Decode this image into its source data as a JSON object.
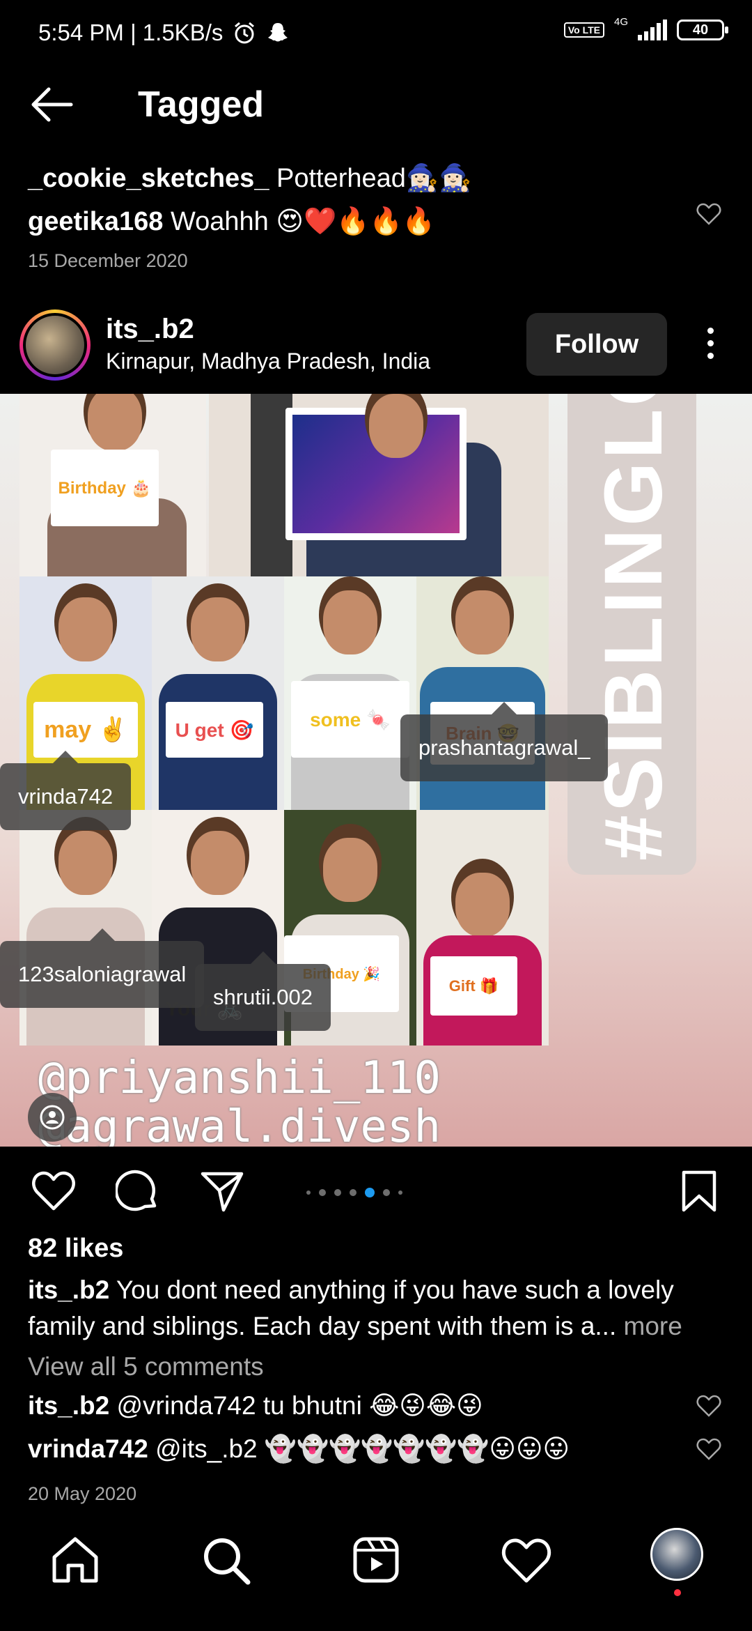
{
  "status_bar": {
    "time_speed": "5:54 PM | 1.5KB/s",
    "volte": "Vo LTE",
    "network": "4G",
    "battery": "40"
  },
  "header": {
    "title": "Tagged"
  },
  "previous_post": {
    "comments": [
      {
        "user": "_cookie_sketches_",
        "text": "Potterhead🧙🏻‍♀️🧙🏻‍♀️"
      },
      {
        "user": "geetika168",
        "text": "Woahhh 😍❤️🔥🔥🔥"
      }
    ],
    "date": "15 December 2020"
  },
  "post": {
    "username": "its_.b2",
    "location": "Kirnapur, Madhya Pradesh, India",
    "follow_label": "Follow",
    "image": {
      "signs": [
        "Birthday 🎂",
        "may ✌️",
        "U get 🎯",
        "some 🍬",
        "Brain 🤓",
        "Birthday 🎉",
        "Gift 🎁",
        "Your 🚲"
      ],
      "hashtag": "#SIBLINGLO",
      "overlay_lines": [
        "@priyanshii_110",
        "@agrawal.divesh"
      ],
      "tags": [
        "prashantagrawal_",
        "vrinda742",
        "123saloniagrawal",
        "shrutii.002"
      ]
    },
    "likes": "82 likes",
    "caption_user": "its_.b2",
    "caption_text": "You dont need anything if you have such a lovely family and siblings. Each day spent with them is a...",
    "caption_more": "more",
    "view_all": "View all 5 comments",
    "comments": [
      {
        "user": "its_.b2",
        "text": "@vrinda742 tu bhutni 😂😜😂😜"
      },
      {
        "user": "vrinda742",
        "text": "@its_.b2 👻👻👻👻👻👻👻😛😛😛"
      }
    ],
    "date": "20 May 2020"
  },
  "carousel": {
    "count": 7,
    "active_index": 4
  },
  "colors": {
    "background": "#000000",
    "accent": "#1d9bf0",
    "muted": "#a8a8a8",
    "button": "#262626",
    "notification": "#ff3040"
  },
  "icons": [
    "back-arrow-icon",
    "heart-icon",
    "comment-icon",
    "share-icon",
    "bookmark-icon",
    "more-icon",
    "home-icon",
    "search-icon",
    "reels-icon",
    "activity-icon",
    "tag-user-icon"
  ]
}
